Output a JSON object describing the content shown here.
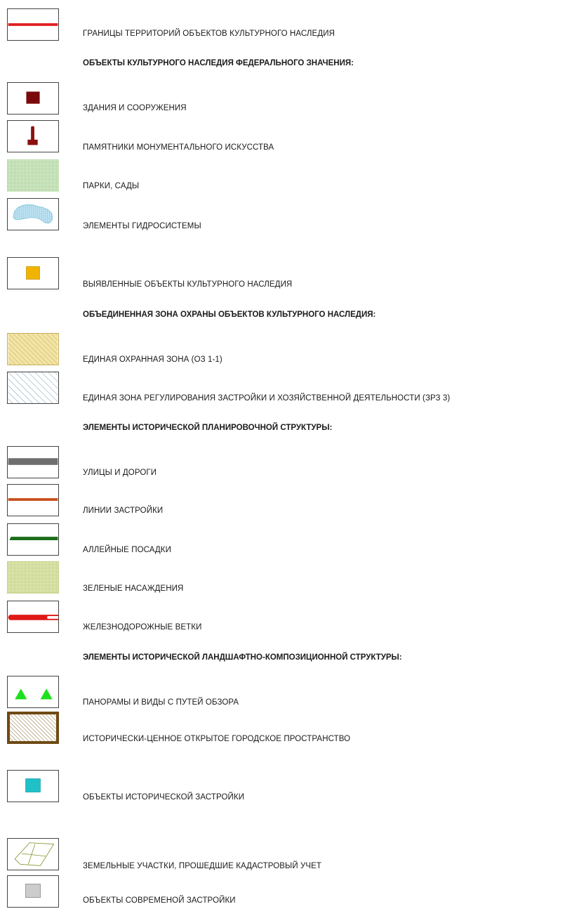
{
  "legend": {
    "items": [
      {
        "key": "boundaries",
        "label": "ГРАНИЦЫ ТЕРРИТОРИЙ ОБЪЕКТОВ КУЛЬТУРНОГО НАСЛЕДИЯ",
        "color": "#e02020"
      },
      {
        "key": "header_federal",
        "label": "ОБЪЕКТЫ КУЛЬТУРНОГО НАСЛЕДИЯ ФЕДЕРАЛЬНОГО ЗНАЧЕНИЯ:"
      },
      {
        "key": "buildings",
        "label": "ЗДАНИЯ И СООРУЖЕНИЯ",
        "color": "#7a0a0a"
      },
      {
        "key": "monuments",
        "label": "ПАМЯТНИКИ МОНУМЕНТАЛЬНОГО ИСКУССТВА",
        "color": "#8a1010"
      },
      {
        "key": "parks",
        "label": "ПАРКИ, САДЫ",
        "color": "#a8d49a"
      },
      {
        "key": "hydro",
        "label": "ЭЛЕМЕНТЫ ГИДРОСИСТЕМЫ",
        "color": "#9fd3ec"
      },
      {
        "key": "identified",
        "label": "ВЫЯВЛЕННЫЕ ОБЪЕКТЫ КУЛЬТУРНОГО НАСЛЕДИЯ",
        "color": "#f0b400"
      },
      {
        "key": "header_zone",
        "label": "ОБЪЕДИНЕННАЯ ЗОНА ОХРАНЫ ОБЪЕКТОВ КУЛЬТУРНОГО НАСЛЕДИЯ:"
      },
      {
        "key": "protection_zone",
        "label": "ЕДИНАЯ ОХРАННАЯ ЗОНА (ОЗ 1-1)",
        "color": "#e8d48a"
      },
      {
        "key": "regulation_zone",
        "label": "ЕДИНАЯ ЗОНА РЕГУЛИРОВАНИЯ ЗАСТРОЙКИ И  ХОЗЯЙСТВЕННОЙ ДЕЯТЕЛЬНОСТИ (ЗРЗ 3)",
        "color": "#7a9ab0"
      },
      {
        "key": "header_planning",
        "label": "ЭЛЕМЕНТЫ ИСТОРИЧЕСКОЙ ПЛАНИРОВОЧНОЙ СТРУКТУРЫ:"
      },
      {
        "key": "streets",
        "label": "УЛИЦЫ И ДОРОГИ",
        "color": "#6e6e6e"
      },
      {
        "key": "building_lines",
        "label": "ЛИНИИ ЗАСТРОЙКИ",
        "color": "#c8501e"
      },
      {
        "key": "alleys",
        "label": "АЛЛЕЙНЫЕ ПОСАДКИ",
        "color": "#1a6e1a"
      },
      {
        "key": "greenery",
        "label": "ЗЕЛЕНЫЕ НАСАЖДЕНИЯ",
        "color": "#c8d890"
      },
      {
        "key": "railways",
        "label": "ЖЕЛЕЗНОДОРОЖНЫЕ ВЕТКИ",
        "color": "#e01818"
      },
      {
        "key": "header_landscape",
        "label": "ЭЛЕМЕНТЫ ИСТОРИЧЕСКОЙ ЛАНДШАФТНО-КОМПОЗИЦИОННОЙ СТРУКТУРЫ:"
      },
      {
        "key": "panoramas",
        "label": "ПАНОРАМЫ И ВИДЫ С ПУТЕЙ ОБЗОРА",
        "color": "#1ee01e"
      },
      {
        "key": "open_space",
        "label": "ИСТОРИЧЕСКИ-ЦЕННОЕ ОТКРЫТОЕ ГОРОДСКОЕ ПРОСТРАНСТВО",
        "color": "#6e4a14"
      },
      {
        "key": "historic_buildings",
        "label": "ОБЪЕКТЫ ИСТОРИЧЕСКОЙ ЗАСТРОЙКИ",
        "color": "#20c0c8"
      },
      {
        "key": "cadastral",
        "label": "ЗЕМЕЛЬНЫЕ УЧАСТКИ, ПРОШЕДШИЕ КАДАСТРОВЫЙ УЧЕТ",
        "color": "#8a9a3a"
      },
      {
        "key": "modern_buildings",
        "label": "ОБЪЕКТЫ СОВРЕМЕНОЙ ЗАСТРОЙКИ",
        "color": "#cccccc"
      }
    ]
  }
}
